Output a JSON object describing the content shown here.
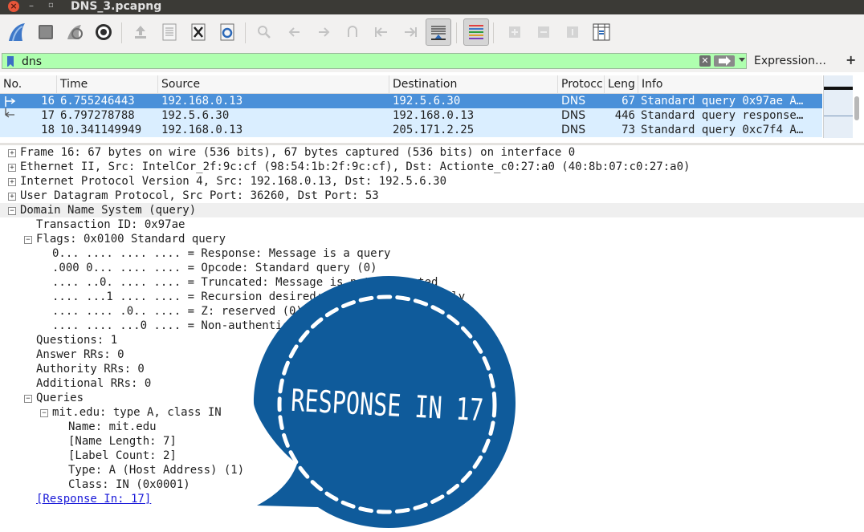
{
  "window": {
    "title": "DNS_3.pcapng"
  },
  "filter": {
    "value": "dns",
    "expression_label": "Expression…",
    "add_label": "+"
  },
  "columns": [
    "No.",
    "Time",
    "Source",
    "Destination",
    "Protocol",
    "Length",
    "Info"
  ],
  "column_header_display": [
    "No.",
    "Time",
    "Source",
    "Destination",
    "Protocc",
    "Leng",
    "Info"
  ],
  "packets": [
    {
      "no": "16",
      "time": "6.755246443",
      "source": "192.168.0.13",
      "destination": "192.5.6.30",
      "protocol": "DNS",
      "length": "67",
      "info": "Standard query 0x97ae A…"
    },
    {
      "no": "17",
      "time": "6.797278788",
      "source": "192.5.6.30",
      "destination": "192.168.0.13",
      "protocol": "DNS",
      "length": "446",
      "info": "Standard query response…"
    },
    {
      "no": "18",
      "time": "10.341149949",
      "source": "192.168.0.13",
      "destination": "205.171.2.25",
      "protocol": "DNS",
      "length": "73",
      "info": "Standard query 0xc7f4 A…"
    }
  ],
  "details": {
    "frame": "Frame 16: 67 bytes on wire (536 bits), 67 bytes captured (536 bits) on interface 0",
    "ethernet": "Ethernet II, Src: IntelCor_2f:9c:cf (98:54:1b:2f:9c:cf), Dst: Actionte_c0:27:a0 (40:8b:07:c0:27:a0)",
    "ip": "Internet Protocol Version 4, Src: 192.168.0.13, Dst: 192.5.6.30",
    "udp": "User Datagram Protocol, Src Port: 36260, Dst Port: 53",
    "dns": "Domain Name System (query)",
    "transaction_id": "Transaction ID: 0x97ae",
    "flags": "Flags: 0x0100 Standard query",
    "flag_lines": [
      "0... .... .... .... = Response: Message is a query",
      ".000 0... .... .... = Opcode: Standard query (0)",
      ".... ..0. .... .... = Truncated: Message is not truncated",
      ".... ...1 .... .... = Recursion desired: Do query recursively",
      ".... .... .0.. .... = Z: reserved (0)",
      ".... .... ...0 .... = Non-authenticated data: Unacceptable"
    ],
    "questions": "Questions: 1",
    "answer_rrs": "Answer RRs: 0",
    "authority_rrs": "Authority RRs: 0",
    "additional_rrs": "Additional RRs: 0",
    "queries": "Queries",
    "query": "mit.edu: type A, class IN",
    "query_fields": [
      "Name: mit.edu",
      "[Name Length: 7]",
      "[Label Count: 2]",
      "Type: A (Host Address) (1)",
      "Class: IN (0x0001)"
    ],
    "response_in": "[Response In: 17]"
  },
  "badge": {
    "text": "RESPONSE IN 17",
    "color": "#0f5b9b"
  },
  "colors": {
    "selected_row": "#4a90d9",
    "row_bg": "#daeeff",
    "filter_ok": "#afffaf"
  }
}
